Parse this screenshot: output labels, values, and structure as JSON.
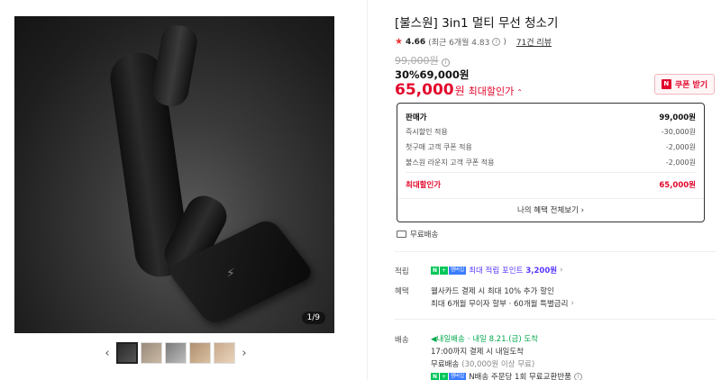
{
  "gallery": {
    "counter": "1/9",
    "prev_icon": "chevron-left-icon",
    "next_icon": "chevron-right-icon",
    "thumb_count": 5
  },
  "product": {
    "title": "[불스원] 3in1 멀티 무선 청소기",
    "rating": {
      "score": "4.66",
      "detail": "(최근 6개월 4.83",
      "review_link": "71건 리뷰"
    },
    "original_price": "99,000원",
    "sale_line": "30%69,000원",
    "final_price": "65,000",
    "final_unit": "원",
    "final_label": "최대할인가",
    "coupon_button": "쿠폰 받기"
  },
  "breakdown": {
    "rows": [
      {
        "label": "판매가",
        "value": "99,000원"
      },
      {
        "label": "즉시할인 적용",
        "value": "-30,000원"
      },
      {
        "label": "첫구매 고객 쿠폰 적용",
        "value": "-2,000원"
      },
      {
        "label": "불스원 라운지 고객 쿠폰 적용",
        "value": "-2,000원"
      }
    ],
    "final": {
      "label": "최대할인가",
      "value": "65,000원"
    },
    "benefits_button": "나의 혜택 전체보기"
  },
  "shipping_note": "무료배송",
  "points": {
    "label": "적립",
    "text": "최대 적립 포인트",
    "value": "3,200원"
  },
  "benefits": {
    "label": "혜택",
    "line1": "웰사카드 결제 시 최대 10% 추가 할인",
    "line2": "최대 6개월 무이자 할부 · 60개월 특별금리"
  },
  "delivery": {
    "label": "배송",
    "badge": "내일배송",
    "date": "· 내일 8.21.(금) 도착",
    "line1": "17:00까지 결제 시 내일도착",
    "line2_main": "무료배송",
    "line2_note": "(30,000원 이상 무료)",
    "line3": "N배송 주문당 1회 무료교환반품"
  },
  "colors": {
    "accent_red": "#e3082c",
    "npay_green": "#03c75a",
    "point_purple": "#5a36ff"
  }
}
